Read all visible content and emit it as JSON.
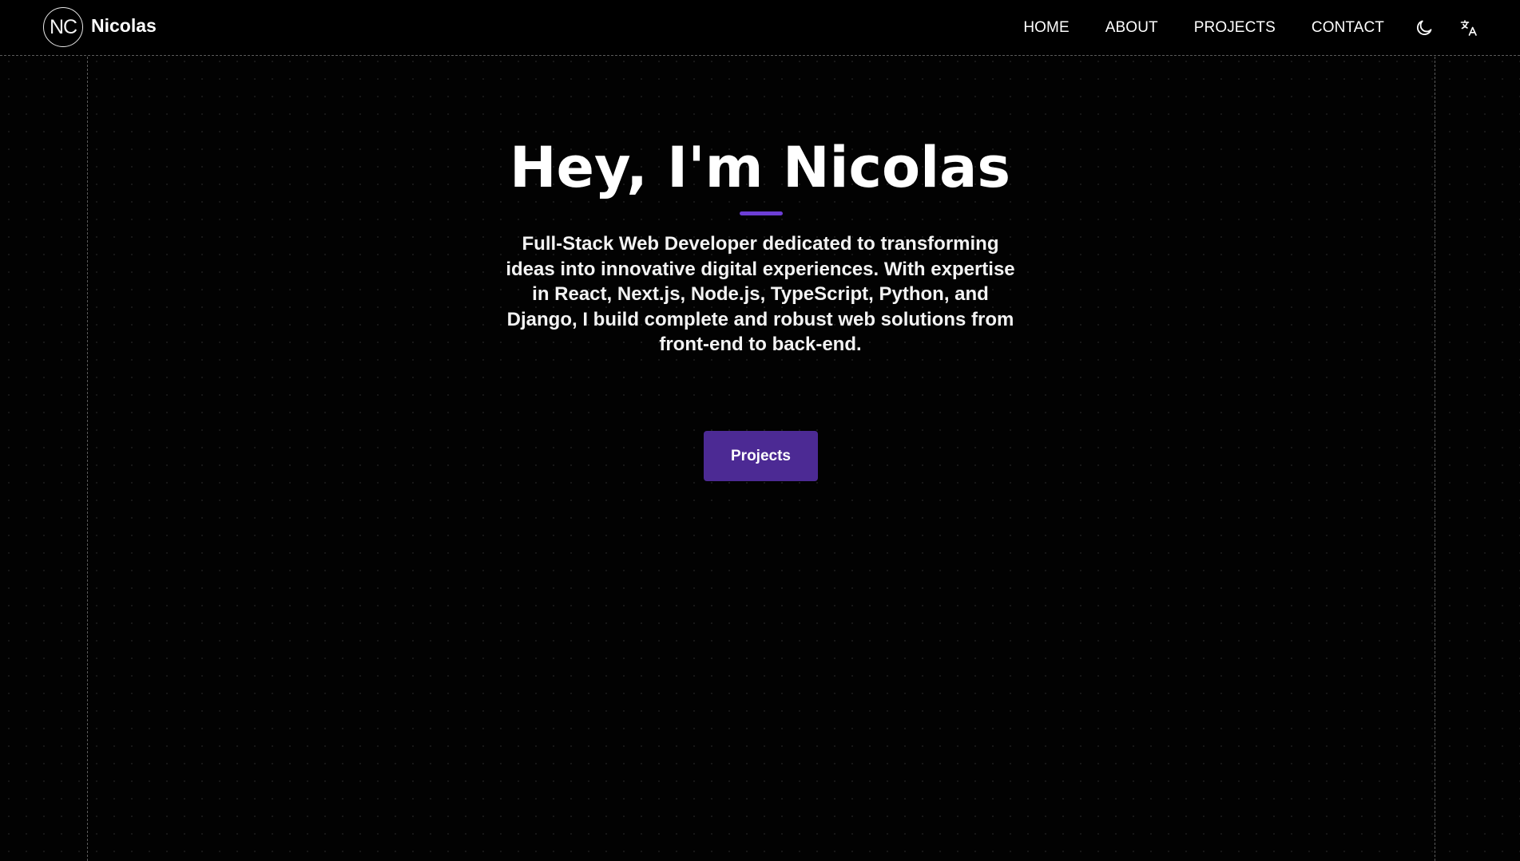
{
  "header": {
    "logo_initials": "NC",
    "brand_name": "Nicolas",
    "nav": [
      {
        "label": "HOME"
      },
      {
        "label": "ABOUT"
      },
      {
        "label": "PROJECTS"
      },
      {
        "label": "CONTACT"
      }
    ],
    "theme_toggle_icon": "moon-icon",
    "language_toggle_icon": "translate-icon"
  },
  "hero": {
    "title": "Hey, I'm Nicolas",
    "description": "Full-Stack Web Developer dedicated to transforming ideas into innovative digital experiences. With expertise in React, Next.js, Node.js, TypeScript, Python, and Django, I build complete and robust web solutions from front-end to back-end.",
    "cta_label": "Projects"
  },
  "colors": {
    "background": "#020202",
    "accent": "#6d3ed6",
    "button": "#4c2a94",
    "text": "#ffffff",
    "frame_lines": "#5a5a5a"
  }
}
